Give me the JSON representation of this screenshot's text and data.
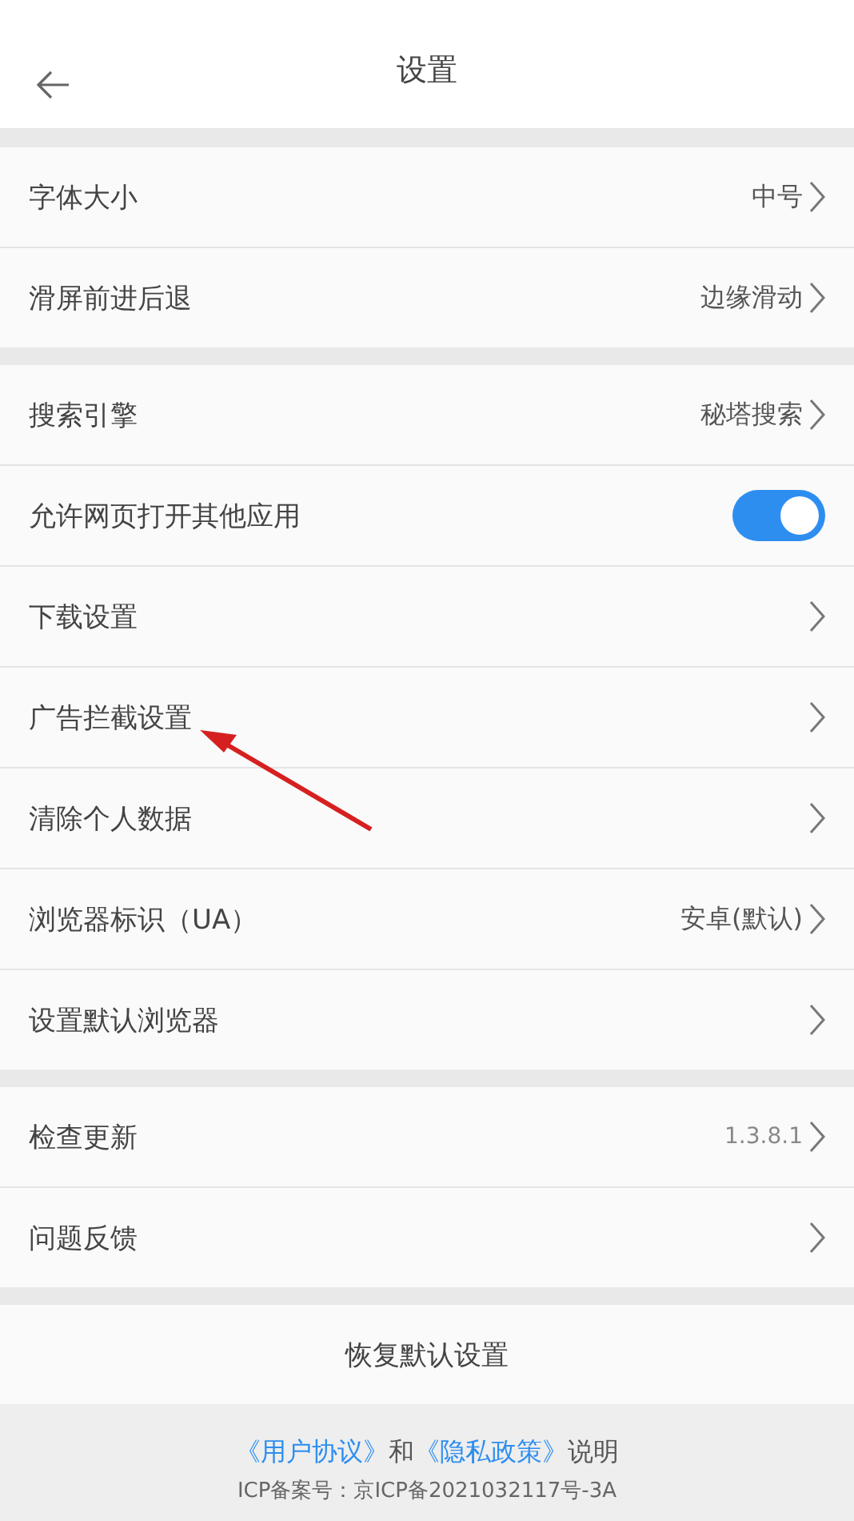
{
  "header": {
    "title": "设置"
  },
  "groups": [
    {
      "rows": [
        {
          "label": "字体大小",
          "kind": "link",
          "value": "中号"
        },
        {
          "label": "滑屏前进后退",
          "kind": "link",
          "value": "边缘滑动"
        }
      ]
    },
    {
      "rows": [
        {
          "label": "搜索引擎",
          "kind": "link",
          "value": "秘塔搜索"
        },
        {
          "label": "允许网页打开其他应用",
          "kind": "toggle",
          "on": true
        },
        {
          "label": "下载设置",
          "kind": "link"
        },
        {
          "label": "广告拦截设置",
          "kind": "link"
        },
        {
          "label": "清除个人数据",
          "kind": "link"
        },
        {
          "label": "浏览器标识（UA）",
          "kind": "link",
          "value": "安卓(默认)"
        },
        {
          "label": "设置默认浏览器",
          "kind": "link"
        }
      ]
    },
    {
      "rows": [
        {
          "label": "检查更新",
          "kind": "version",
          "value": "1.3.8.1"
        },
        {
          "label": "问题反馈",
          "kind": "link"
        }
      ]
    }
  ],
  "reset_button": "恢复默认设置",
  "footer": {
    "agreement": [
      {
        "text": "《用户协议》",
        "kind": "link"
      },
      {
        "text": "和",
        "kind": "plain"
      },
      {
        "text": "《隐私政策》",
        "kind": "link"
      },
      {
        "text": "说明",
        "kind": "plain"
      }
    ],
    "icp": "ICP备案号：京ICP备2021032117号-3A"
  },
  "annotation": {
    "kind": "arrow"
  }
}
